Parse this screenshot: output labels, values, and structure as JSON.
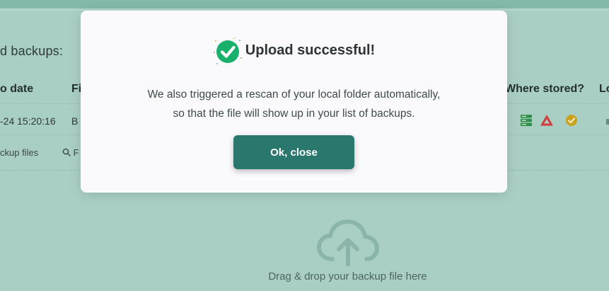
{
  "background": {
    "heading": "d backups:",
    "table": {
      "headers": [
        "o date",
        "Fi",
        "Where stored?",
        "Lo"
      ],
      "row": {
        "date": "-24 15:20:16",
        "file": "B"
      }
    },
    "toolbar": {
      "backup_files": "ckup files",
      "find": "F"
    },
    "upload": {
      "drop_text": "Drag & drop your backup file here"
    }
  },
  "modal": {
    "title": "Upload successful!",
    "message_line1": "We also triggered a rescan of your local folder automatically,",
    "message_line2": "so that the file will show up in your list of backups.",
    "ok_button": "Ok, close"
  },
  "colors": {
    "overlay_bg": "#a9cfc4",
    "primary_button": "#2a776d",
    "success_green": "#18b06a",
    "storage_green": "#2f8f4a",
    "drive_red": "#d23c3c",
    "gold_check": "#c9a21e"
  },
  "icons": [
    "checkmark-success-icon",
    "server-storage-icon",
    "google-drive-icon",
    "verified-check-icon",
    "cloud-upload-icon",
    "search-icon"
  ]
}
